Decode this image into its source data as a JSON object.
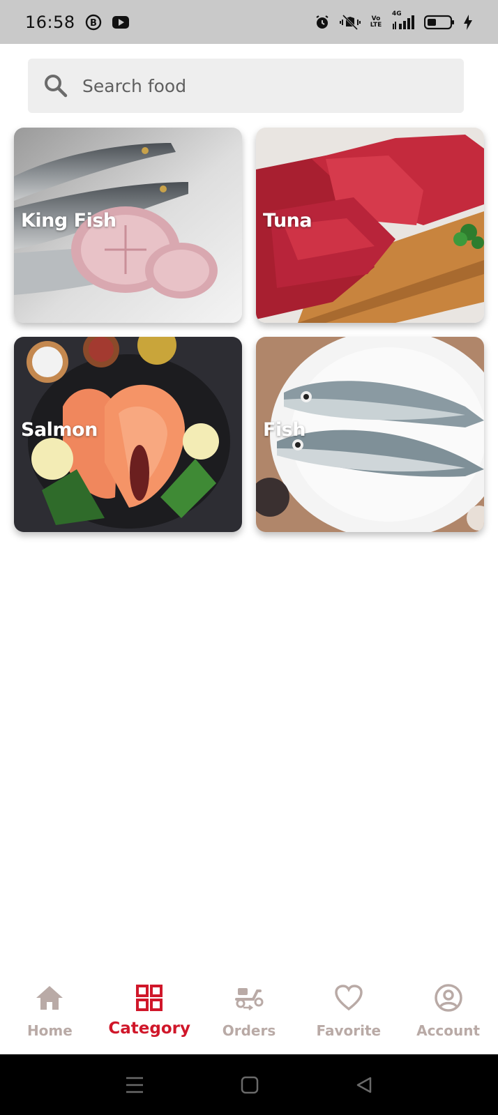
{
  "status_bar": {
    "time": "16:58",
    "network_label_volte": "Vo LTE",
    "network_label_4g": "4G",
    "icons": [
      "b-circle-icon",
      "youtube-icon",
      "alarm-icon",
      "mute-vibrate-icon",
      "volte-icon",
      "signal-icon",
      "battery-icon",
      "charging-icon"
    ]
  },
  "search": {
    "placeholder": "Search food",
    "value": ""
  },
  "categories": [
    {
      "label": "King Fish"
    },
    {
      "label": "Tuna"
    },
    {
      "label": "Salmon"
    },
    {
      "label": "Fish"
    }
  ],
  "bottom_nav": {
    "items": [
      {
        "label": "Home",
        "icon": "home-icon",
        "active": false
      },
      {
        "label": "Category",
        "icon": "grid-icon",
        "active": true
      },
      {
        "label": "Orders",
        "icon": "scooter-icon",
        "active": false
      },
      {
        "label": "Favorite",
        "icon": "heart-icon",
        "active": false
      },
      {
        "label": "Account",
        "icon": "account-icon",
        "active": false
      }
    ]
  },
  "colors": {
    "accent": "#d0172a",
    "inactive_nav": "#b9aaa6",
    "status_bar_bg": "#c9c9c9",
    "search_bg": "#eeeeee"
  }
}
